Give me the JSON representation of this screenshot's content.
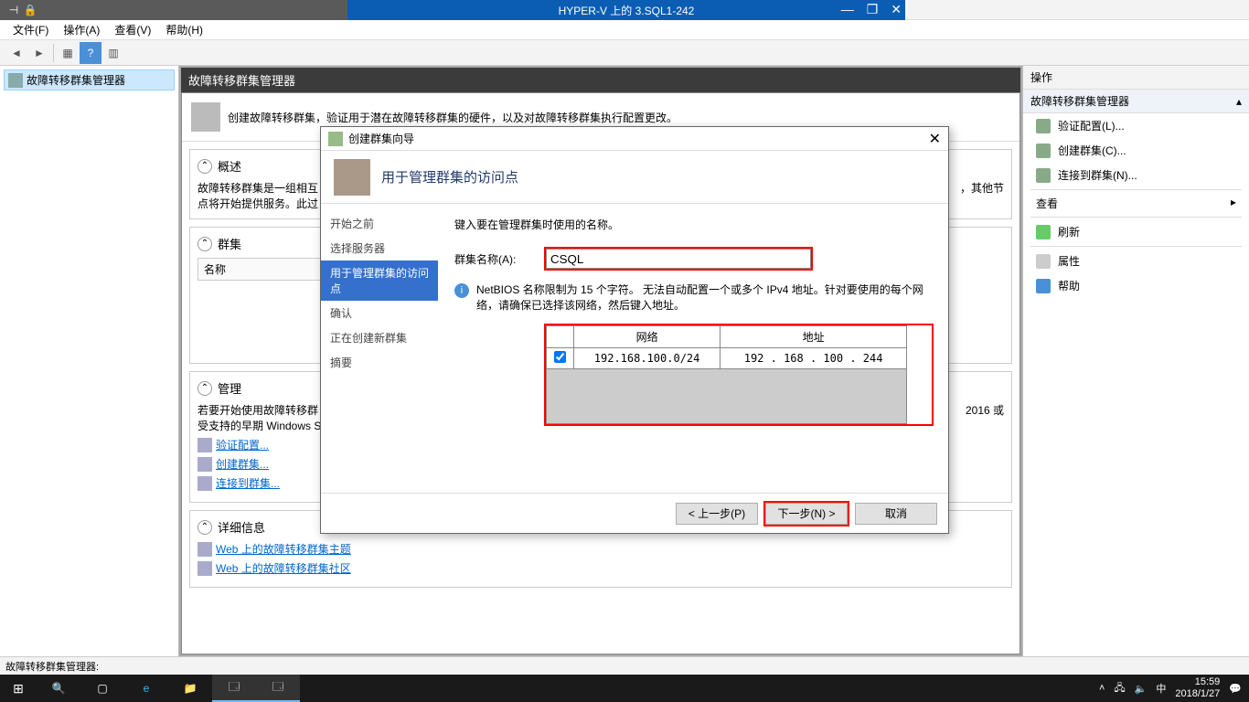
{
  "host": {
    "min": "—",
    "max": "□",
    "close": "✕"
  },
  "vm": {
    "title": "HYPER-V 上的 3.SQL1-242",
    "pin": "⊣",
    "lock": "🔒",
    "min": "—",
    "restore": "❐",
    "close": "✕"
  },
  "mmc": {
    "title": "故障转移群集管理器",
    "menu": {
      "file": "文件(F)",
      "action": "操作(A)",
      "view": "查看(V)",
      "help": "帮助(H)"
    },
    "tree_root": "故障转移群集管理器",
    "center_title": "故障转移群集管理器",
    "center_desc": "创建故障转移群集，验证用于潜在故障转移群集的硬件，以及对故障转移群集执行配置更改。",
    "overview_hdr": "概述",
    "overview_text": "故障转移群集是一组相互\n点将开始提供服务。此过",
    "overview_tail": "，其他节",
    "clusters_hdr": "群集",
    "clusters_name_col": "名称",
    "manage_hdr": "管理",
    "manage_text": "若要开始使用故障转移群\n受支持的早期 Windows S",
    "manage_tail": "2016 或",
    "link_validate": "验证配置...",
    "link_create": "创建群集...",
    "link_connect": "连接到群集...",
    "details_hdr": "详细信息",
    "link_web_topic": "Web 上的故障转移群集主题",
    "link_web_community": "Web 上的故障转移群集社区",
    "status": "故障转移群集管理器:"
  },
  "actions": {
    "title": "操作",
    "subtitle": "故障转移群集管理器",
    "items": {
      "validate": "验证配置(L)...",
      "create": "创建群集(C)...",
      "connect": "连接到群集(N)...",
      "view": "查看",
      "refresh": "刷新",
      "properties": "属性",
      "help": "帮助"
    }
  },
  "wizard": {
    "title": "创建群集向导",
    "header": "用于管理群集的访问点",
    "nav": {
      "before": "开始之前",
      "select_server": "选择服务器",
      "access_point": "用于管理群集的访问点",
      "confirm": "确认",
      "creating": "正在创建新群集",
      "summary": "摘要"
    },
    "intro": "键入要在管理群集时使用的名称。",
    "name_label": "群集名称(A):",
    "name_value": "CSQL",
    "info_text": "NetBIOS 名称限制为 15 个字符。 无法自动配置一个或多个 IPv4 地址。针对要使用的每个网络，请确保已选择该网络，然后键入地址。",
    "net_col": "网络",
    "addr_col": "地址",
    "net_value": "192.168.100.0/24",
    "addr_value": "192 . 168 . 100 . 244",
    "prev": "< 上一步(P)",
    "next": "下一步(N) >",
    "cancel": "取消"
  },
  "taskbar": {
    "time": "15:59",
    "date": "2018/1/27",
    "ime": "中"
  }
}
